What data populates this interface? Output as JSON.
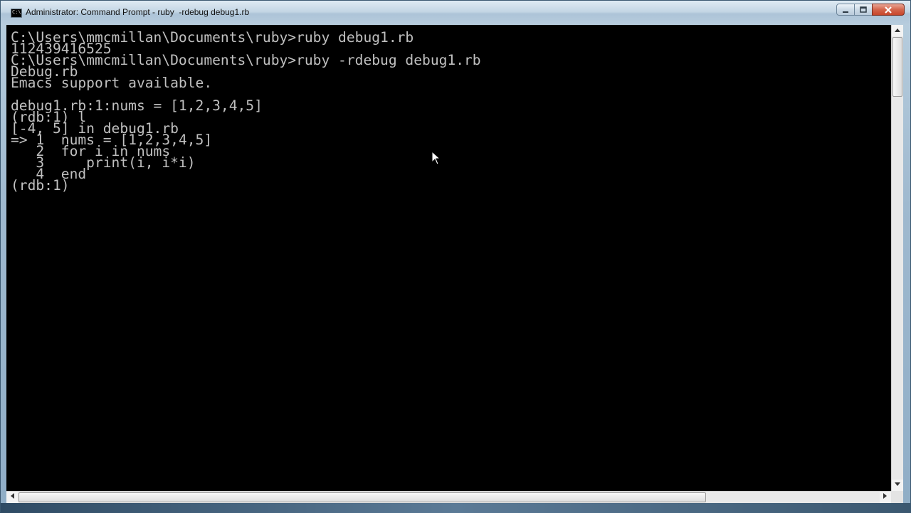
{
  "window": {
    "title": "Administrator: Command Prompt - ruby  -rdebug debug1.rb",
    "icon_label": "C:\\",
    "buttons": {
      "minimize": "minimize-icon",
      "maximize": "maximize-icon",
      "close": "close-icon"
    }
  },
  "console": {
    "background": "#000000",
    "text_color": "#c0c0c0",
    "text": "C:\\Users\\mmcmillan\\Documents\\ruby>ruby debug1.rb\n112439416525\nC:\\Users\\mmcmillan\\Documents\\ruby>ruby -rdebug debug1.rb\nDebug.rb\nEmacs support available.\n\ndebug1.rb:1:nums = [1,2,3,4,5]\n(rdb:1) l\n[-4, 5] in debug1.rb\n=> 1  nums = [1,2,3,4,5]\n   2  for i in nums\n   3     print(i, i*i)\n   4  end\n(rdb:1)"
  },
  "scrollbars": {
    "vertical": {
      "up_icon": "scroll-up-arrow-icon",
      "down_icon": "scroll-down-arrow-icon"
    },
    "horizontal": {
      "left_icon": "scroll-left-arrow-icon",
      "right_icon": "scroll-right-arrow-icon"
    }
  }
}
